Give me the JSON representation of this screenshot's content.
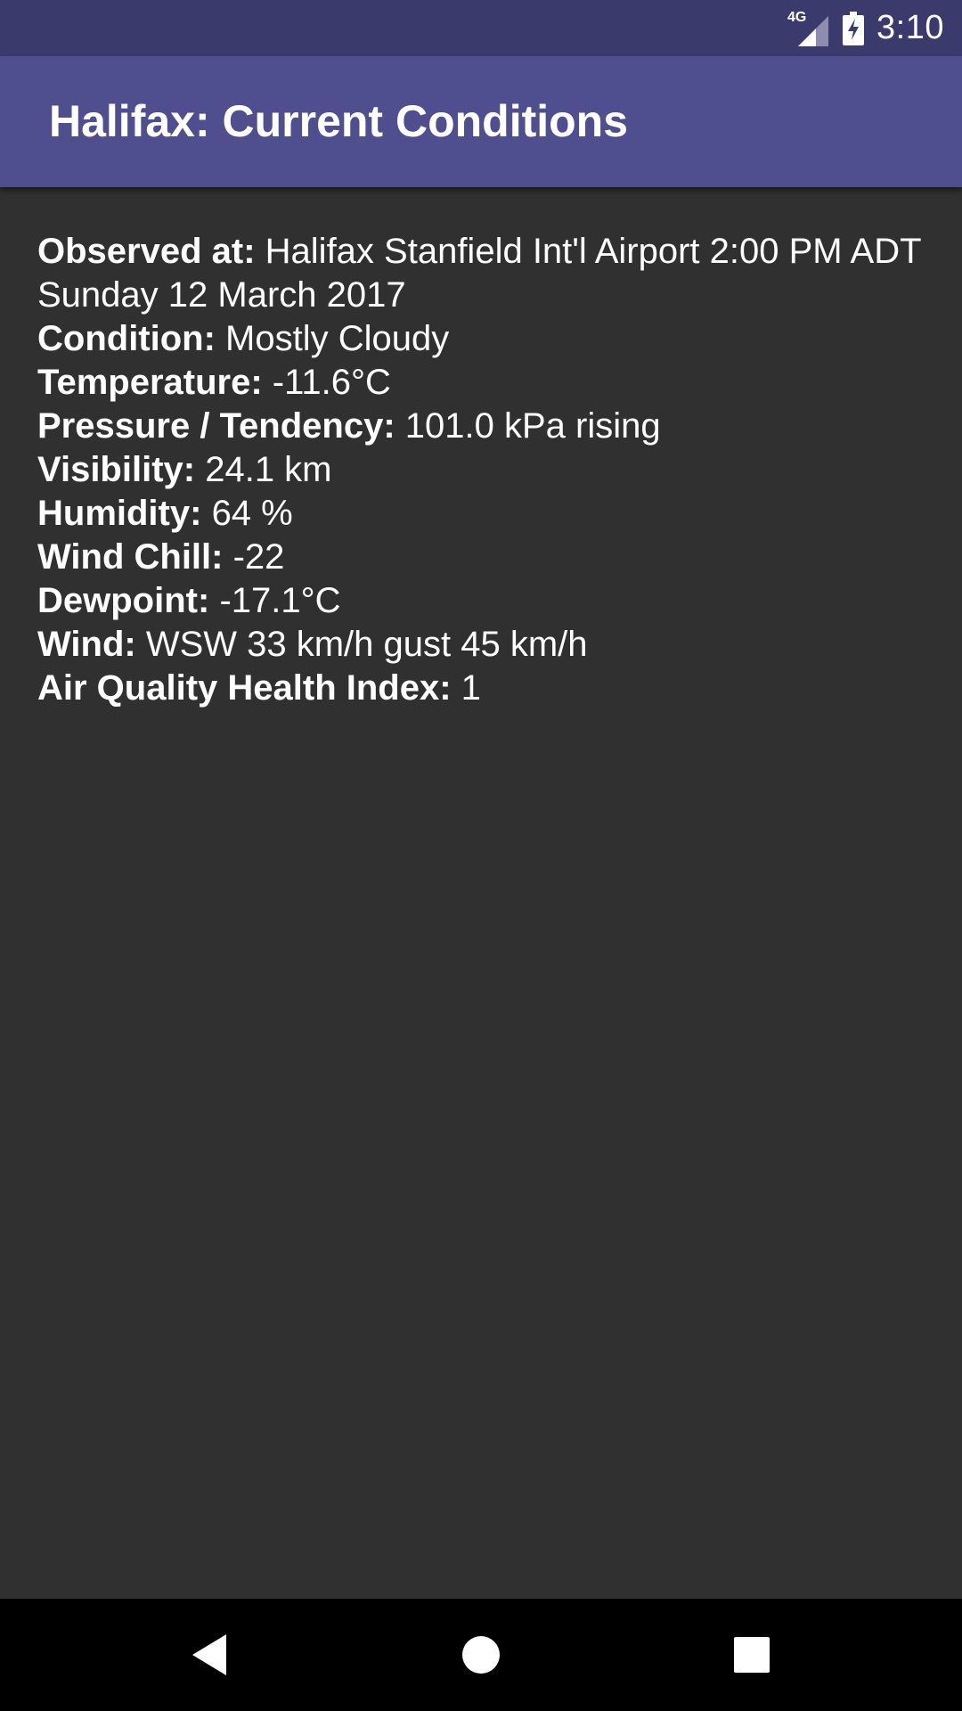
{
  "status_bar": {
    "network_label": "4G",
    "time": "3:10",
    "icons": [
      "signal-icon",
      "battery-charging-icon"
    ]
  },
  "app_bar": {
    "title": "Halifax: Current Conditions"
  },
  "conditions": [
    {
      "label": "Observed at:",
      "value": "Halifax Stanfield Int'l Airport 2:00 PM ADT Sunday 12 March 2017"
    },
    {
      "label": "Condition:",
      "value": "Mostly Cloudy"
    },
    {
      "label": "Temperature:",
      "value": "-11.6°C"
    },
    {
      "label": "Pressure / Tendency:",
      "value": "101.0 kPa rising"
    },
    {
      "label": "Visibility:",
      "value": "24.1 km"
    },
    {
      "label": "Humidity:",
      "value": "64 %"
    },
    {
      "label": "Wind Chill:",
      "value": "-22"
    },
    {
      "label": "Dewpoint:",
      "value": "-17.1°C"
    },
    {
      "label": "Wind:",
      "value": "WSW 33 km/h gust 45 km/h"
    },
    {
      "label": "Air Quality Health Index:",
      "value": "1"
    }
  ],
  "nav_bar": {
    "icons": [
      "back-icon",
      "home-icon",
      "recent-apps-icon"
    ]
  },
  "colors": {
    "status_bar": "#3b3a6c",
    "app_bar": "#4f4e8f",
    "background": "#303030",
    "nav_bar": "#000000",
    "text": "#ffffff"
  }
}
